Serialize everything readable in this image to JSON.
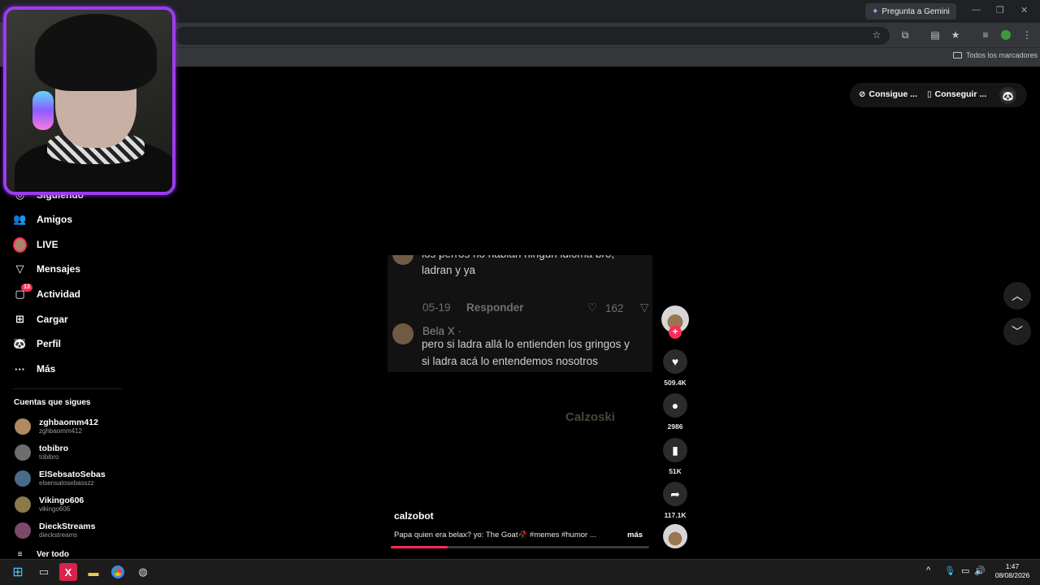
{
  "browser": {
    "gemini_button": "Pregunta a Gemini",
    "bookmarks_all": "Todos los marcadores",
    "icons": [
      "star-icon",
      "extensions-icon",
      "tab-icon",
      "bookmark-star-icon",
      "media-icon",
      "profile-icon",
      "menu-icon"
    ]
  },
  "topbar": {
    "get_coins": "Consigue ...",
    "get_app": "Conseguir ..."
  },
  "sidebar": {
    "items": [
      {
        "label": "Siguiendo",
        "icon": "following-icon"
      },
      {
        "label": "Amigos",
        "icon": "friends-icon"
      },
      {
        "label": "LIVE",
        "icon": "live-icon"
      },
      {
        "label": "Mensajes",
        "icon": "messages-icon"
      },
      {
        "label": "Actividad",
        "icon": "activity-icon",
        "badge": "13"
      },
      {
        "label": "Cargar",
        "icon": "upload-icon"
      },
      {
        "label": "Perfil",
        "icon": "profile-icon"
      },
      {
        "label": "Más",
        "icon": "more-icon"
      }
    ],
    "following_title": "Cuentas que sigues",
    "following": [
      {
        "name": "zghbaomm412",
        "handle": "zghbaomm412",
        "color": "#b08a5e"
      },
      {
        "name": "tobibro",
        "handle": "tobibro",
        "color": "#6d6d6d"
      },
      {
        "name": "ElSebsatoSebas",
        "handle": "elsensatosebasszz",
        "color": "#4a6a8a"
      },
      {
        "name": "Vikingo606",
        "handle": "vikingo606",
        "color": "#8a7a4a"
      },
      {
        "name": "DieckStreams",
        "handle": "dieckstreams",
        "color": "#7a4a6a"
      }
    ],
    "see_all": "Ver todo"
  },
  "video": {
    "comment1": {
      "text_line1": "los perros no hablan ningun idioma bro,",
      "text_line2": "ladran y ya",
      "date": "05-19",
      "reply": "Responder",
      "likes": "162"
    },
    "comment2": {
      "author": "Bela X ·",
      "text_line1": "pero si ladra allá lo entienden los gringos y",
      "text_line2": "si ladra acá lo entendemos nosotros"
    },
    "watermark": "Calzoski",
    "author": "calzobot",
    "description": "Papa quien era belax? yo: The Goat🥀 #memes #humor ...",
    "more": "más",
    "progress": 0.22
  },
  "actions": {
    "likes": "509.4K",
    "comments": "2986",
    "saves": "51K",
    "shares": "117.1K"
  },
  "taskbar": {
    "time": "1:47",
    "date": "08/08/2026"
  }
}
